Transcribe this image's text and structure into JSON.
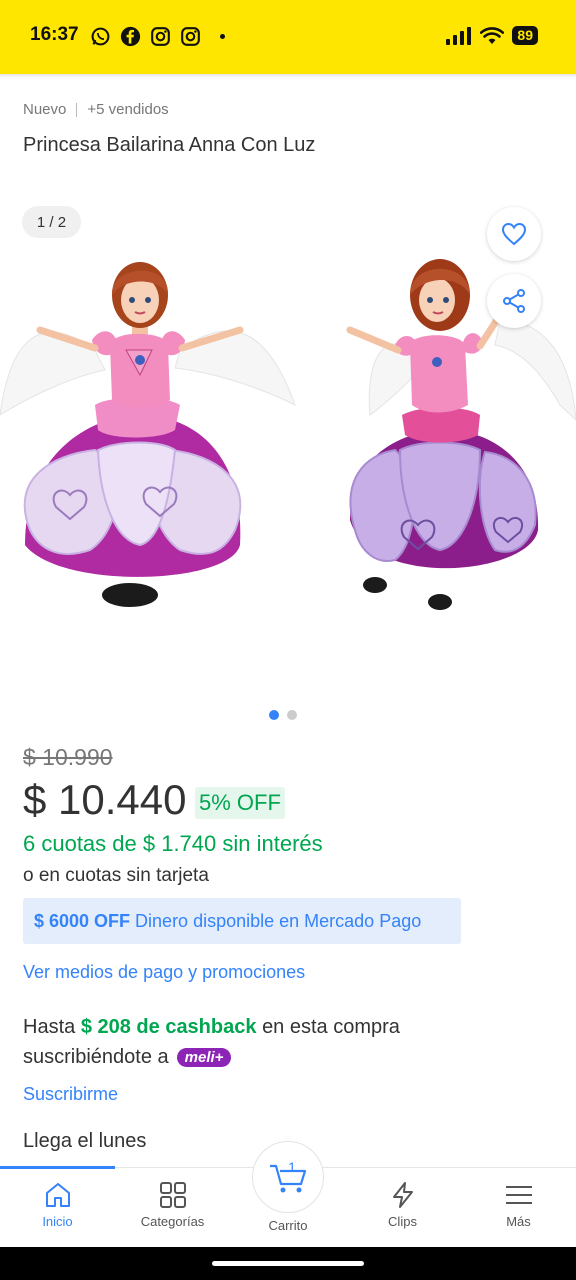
{
  "status_bar": {
    "time": "16:37",
    "battery": "89",
    "apps": [
      "whatsapp-icon",
      "facebook-icon",
      "instagram-icon",
      "instagram-icon"
    ]
  },
  "product": {
    "condition": "Nuevo",
    "sold": "+5 vendidos",
    "title": "Princesa Bailarina Anna Con Luz"
  },
  "gallery": {
    "counter": "1 / 2",
    "current_index": 1,
    "total": 2
  },
  "pricing": {
    "old_price": "$ 10.990",
    "price": "$ 10.440",
    "discount": "5% OFF",
    "installments": "6 cuotas de $ 1.740 sin interés",
    "no_card": "o en cuotas sin tarjeta"
  },
  "promo": {
    "strong": "$ 6000 OFF",
    "text": "Dinero disponible en Mercado Pago"
  },
  "payment_link": "Ver medios de pago y promociones",
  "cashback": {
    "prefix": "Hasta",
    "amount": "$ 208 de cashback",
    "suffix": "en esta compra",
    "line2": "suscribiéndote a",
    "badge": "meli+"
  },
  "subscribe_link": "Suscribirme",
  "delivery": "Llega el lunes",
  "tabbar": {
    "items": [
      {
        "label": "Inicio",
        "icon": "home-icon",
        "active": true
      },
      {
        "label": "Categorías",
        "icon": "grid-icon"
      },
      {
        "label": "Carrito",
        "icon": "cart-icon",
        "badge": "1"
      },
      {
        "label": "Clips",
        "icon": "lightning-icon"
      },
      {
        "label": "Más",
        "icon": "menu-icon"
      }
    ]
  },
  "colors": {
    "brand_yellow": "#ffe600",
    "accent_blue": "#3483fa",
    "success_green": "#00a650",
    "meli_purple": "#8c24b5"
  }
}
